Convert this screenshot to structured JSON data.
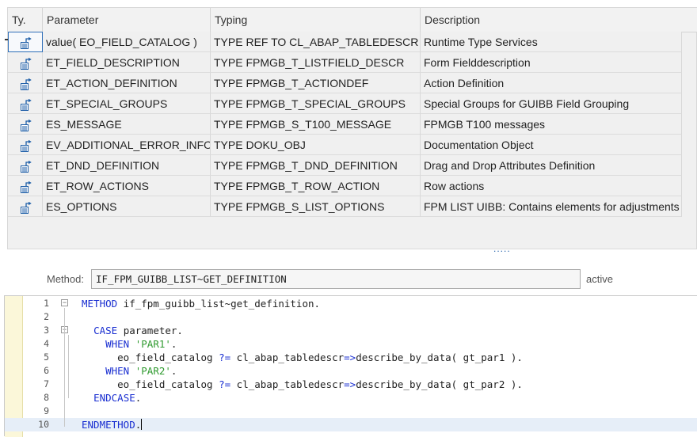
{
  "table": {
    "headers": [
      "Ty.",
      "Parameter",
      "Typing",
      "Description"
    ],
    "rows": [
      {
        "parameter": "value( EO_FIELD_CATALOG )",
        "typing": "TYPE REF TO CL_ABAP_TABLEDESCR",
        "description": "Runtime Type Services",
        "selected": true
      },
      {
        "parameter": "ET_FIELD_DESCRIPTION",
        "typing": "TYPE FPMGB_T_LISTFIELD_DESCR",
        "description": "Form Fielddescription"
      },
      {
        "parameter": "ET_ACTION_DEFINITION",
        "typing": "TYPE FPMGB_T_ACTIONDEF",
        "description": "Action Definition"
      },
      {
        "parameter": "ET_SPECIAL_GROUPS",
        "typing": "TYPE FPMGB_T_SPECIAL_GROUPS",
        "description": "Special Groups for GUIBB Field Grouping"
      },
      {
        "parameter": "ES_MESSAGE",
        "typing": "TYPE FPMGB_S_T100_MESSAGE",
        "description": "FPMGB T100 messages"
      },
      {
        "parameter": "EV_ADDITIONAL_ERROR_INFO",
        "typing": "TYPE DOKU_OBJ",
        "description": "Documentation Object"
      },
      {
        "parameter": "ET_DND_DEFINITION",
        "typing": "TYPE FPMGB_T_DND_DEFINITION",
        "description": "Drag and Drop Attributes Definition"
      },
      {
        "parameter": "ET_ROW_ACTIONS",
        "typing": "TYPE FPMGB_T_ROW_ACTION",
        "description": "Row actions"
      },
      {
        "parameter": "ES_OPTIONS",
        "typing": "TYPE FPMGB_S_LIST_OPTIONS",
        "description": "FPM LIST UIBB: Contains elements for adjustments"
      }
    ],
    "row_icon": "exporting-parameter-icon",
    "splitter_handle": "....."
  },
  "method": {
    "label": "Method:",
    "name": "IF_FPM_GUIBB_LIST~GET_DEFINITION",
    "status": "active"
  },
  "editor": {
    "current_line": 10,
    "lines": [
      {
        "num": "1",
        "fold": "minus",
        "tokens": [
          {
            "t": "METHOD",
            "c": "kw"
          },
          {
            "t": " if_fpm_guibb_list~get_definition.",
            "c": ""
          }
        ]
      },
      {
        "num": "2",
        "tokens": []
      },
      {
        "num": "3",
        "fold": "minus",
        "tokens": [
          {
            "t": "  ",
            "c": ""
          },
          {
            "t": "CASE",
            "c": "kw"
          },
          {
            "t": " parameter.",
            "c": ""
          }
        ]
      },
      {
        "num": "4",
        "tokens": [
          {
            "t": "    ",
            "c": ""
          },
          {
            "t": "WHEN",
            "c": "kw"
          },
          {
            "t": " ",
            "c": ""
          },
          {
            "t": "'PAR1'",
            "c": "str"
          },
          {
            "t": ".",
            "c": ""
          }
        ]
      },
      {
        "num": "5",
        "tokens": [
          {
            "t": "      eo_field_catalog ",
            "c": ""
          },
          {
            "t": "?=",
            "c": "kw"
          },
          {
            "t": " cl_abap_tabledescr",
            "c": ""
          },
          {
            "t": "=>",
            "c": "ptr"
          },
          {
            "t": "describe_by_data( gt_par1 ).",
            "c": ""
          }
        ]
      },
      {
        "num": "6",
        "tokens": [
          {
            "t": "    ",
            "c": ""
          },
          {
            "t": "WHEN",
            "c": "kw"
          },
          {
            "t": " ",
            "c": ""
          },
          {
            "t": "'PAR2'",
            "c": "str"
          },
          {
            "t": ".",
            "c": ""
          }
        ]
      },
      {
        "num": "7",
        "tokens": [
          {
            "t": "      eo_field_catalog ",
            "c": ""
          },
          {
            "t": "?=",
            "c": "kw"
          },
          {
            "t": " cl_abap_tabledescr",
            "c": ""
          },
          {
            "t": "=>",
            "c": "ptr"
          },
          {
            "t": "describe_by_data( gt_par2 ).",
            "c": ""
          }
        ]
      },
      {
        "num": "8",
        "tokens": [
          {
            "t": "  ",
            "c": ""
          },
          {
            "t": "ENDCASE",
            "c": "kw"
          },
          {
            "t": ".",
            "c": ""
          }
        ]
      },
      {
        "num": "9",
        "tokens": []
      },
      {
        "num": "10",
        "tokens": [
          {
            "t": "ENDMETHOD",
            "c": "kw"
          },
          {
            "t": ".",
            "c": ""
          }
        ]
      }
    ]
  }
}
